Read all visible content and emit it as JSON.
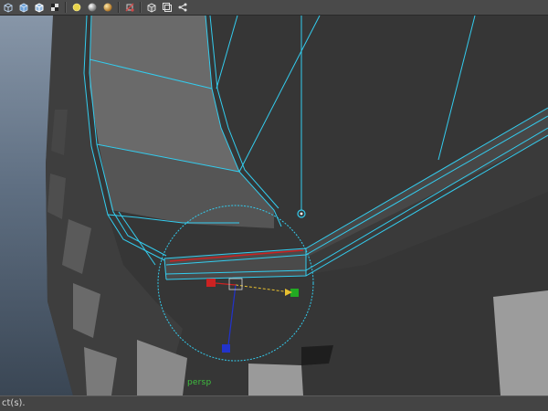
{
  "toolbar": {
    "buttons": [
      {
        "name": "wireframe-icon"
      },
      {
        "name": "smooth-shade-icon"
      },
      {
        "name": "wireframe-on-shaded-icon"
      },
      {
        "name": "textured-icon"
      },
      {
        "name": "lighting-icon"
      },
      {
        "name": "shadows-icon"
      },
      {
        "name": "ambient-occlusion-icon"
      },
      {
        "name": "xray-icon"
      },
      {
        "name": "isolate-select-icon"
      },
      {
        "name": "camera-gate-icon"
      },
      {
        "name": "snapshot-icon"
      }
    ],
    "colors": {
      "bar": "#4a4a4a",
      "icon_blue": "#6aa0d8",
      "icon_yellow": "#e8d44a",
      "icon_red": "#d04848"
    }
  },
  "viewport": {
    "camera_label": "persp",
    "colors": {
      "mesh_dark": "#3a3a3a",
      "mesh_mid": "#5a5a5a",
      "mesh_light": "#8a8a8a",
      "wire_highlight": "#33ccee",
      "selected_edge": "#cc2222",
      "manip_x": "#cc2222",
      "manip_y": "#22aa22",
      "manip_z": "#2233cc",
      "manip_center": "#e8c030"
    }
  },
  "status": {
    "text": "ct(s)."
  }
}
